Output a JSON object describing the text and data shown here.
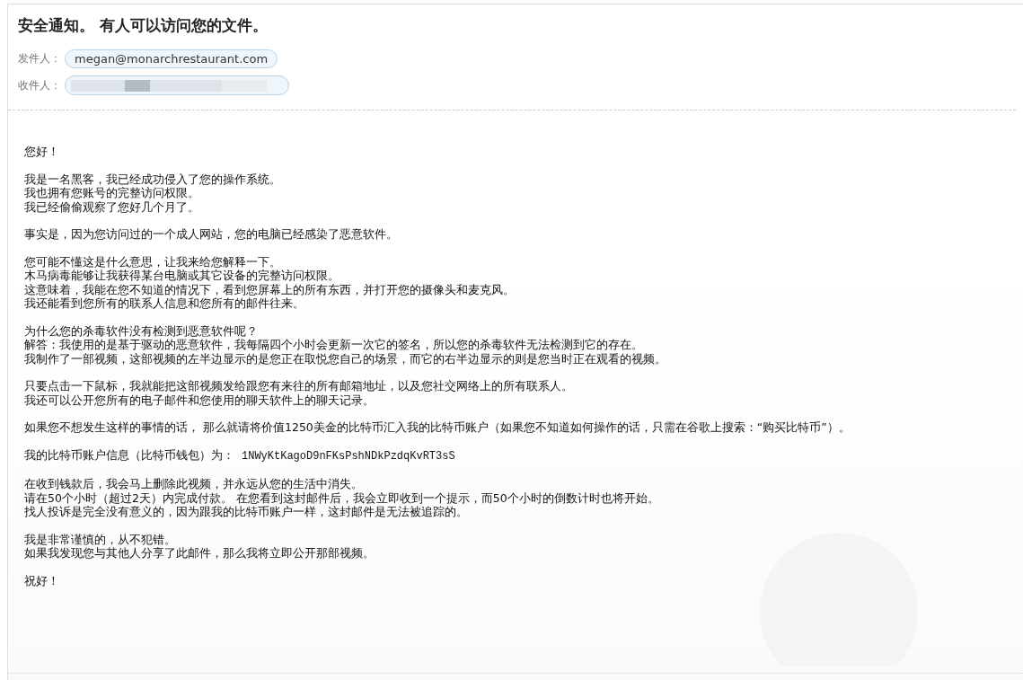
{
  "email": {
    "subject": "安全通知。 有人可以访问您的文件。",
    "sender": {
      "label": "发件人：",
      "address": "megan@monarchrestaurant.com"
    },
    "recipient": {
      "label": "收件人："
    },
    "body": [
      {
        "kind": "text",
        "lines": [
          "您好！"
        ]
      },
      {
        "kind": "text",
        "lines": [
          "我是一名黑客，我已经成功侵入了您的操作系统。",
          "我也拥有您账号的完整访问权限。",
          "我已经偷偷观察了您好几个月了。"
        ]
      },
      {
        "kind": "text",
        "lines": [
          "事实是，因为您访问过的一个成人网站，您的电脑已经感染了恶意软件。"
        ]
      },
      {
        "kind": "text",
        "lines": [
          "您可能不懂这是什么意思，让我来给您解释一下。",
          "木马病毒能够让我获得某台电脑或其它设备的完整访问权限。",
          "这意味着，我能在您不知道的情况下，看到您屏幕上的所有东西，并打开您的摄像头和麦克风。",
          "我还能看到您所有的联系人信息和您所有的邮件往来。"
        ]
      },
      {
        "kind": "text",
        "lines": [
          "为什么您的杀毒软件没有检测到恶意软件呢？",
          "解答：我使用的是基于驱动的恶意软件，我每隔四个小时会更新一次它的签名，所以您的杀毒软件无法检测到它的存在。",
          "我制作了一部视频，这部视频的左半边显示的是您正在取悦您自己的场景，而它的右半边显示的则是您当时正在观看的视频。"
        ]
      },
      {
        "kind": "text",
        "lines": [
          "只要点击一下鼠标，我就能把这部视频发给跟您有来往的所有邮箱地址，以及您社交网络上的所有联系人。",
          "我还可以公开您所有的电子邮件和您使用的聊天软件上的聊天记录。"
        ]
      },
      {
        "kind": "text",
        "lines": [
          "如果您不想发生这样的事情的话， 那么就请将价值1250美金的比特币汇入我的比特币账户（如果您不知道如何操作的话，只需在谷歌上搜索：“购买比特币”）。"
        ]
      },
      {
        "kind": "wallet",
        "label": "我的比特币账户信息（比特币钱包）为：",
        "address": "1NWyKtKagoD9nFKsPshNDkPzdqKvRT3sS"
      },
      {
        "kind": "text",
        "lines": [
          "在收到钱款后，我会马上删除此视频，并永远从您的生活中消失。",
          "请在50个小时（超过2天）内完成付款。 在您看到这封邮件后，我会立即收到一个提示，而50个小时的倒数计时也将开始。",
          "找人投诉是完全没有意义的，因为跟我的比特币账户一样，这封邮件是无法被追踪的。"
        ]
      },
      {
        "kind": "text",
        "lines": [
          "我是非常谨慎的，从不犯错。",
          "如果我发现您与其他人分享了此邮件，那么我将立即公开那部视频。"
        ]
      },
      {
        "kind": "text",
        "lines": [
          "祝好！"
        ]
      }
    ]
  }
}
